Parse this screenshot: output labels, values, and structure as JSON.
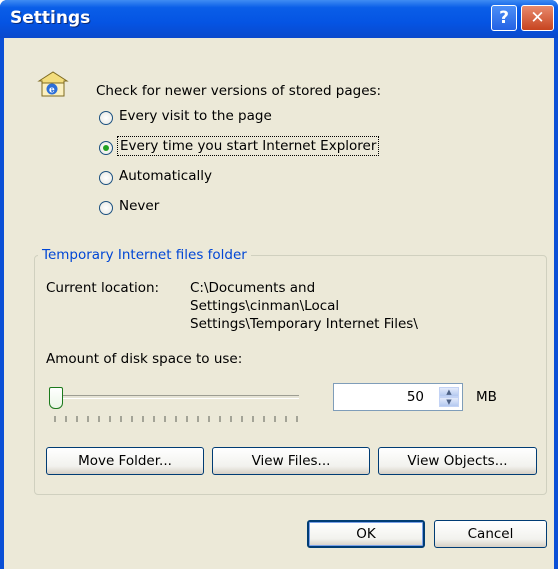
{
  "window": {
    "title": "Settings",
    "help_glyph": "?",
    "close_glyph": "✕"
  },
  "check_section": {
    "heading": "Check for newer versions of stored pages:",
    "options": [
      {
        "label": "Every visit to the page",
        "selected": false
      },
      {
        "label": "Every time you start Internet Explorer",
        "selected": true
      },
      {
        "label": "Automatically",
        "selected": false
      },
      {
        "label": "Never",
        "selected": false
      }
    ]
  },
  "temp_folder": {
    "group_title": "Temporary Internet files folder",
    "location_label": "Current location:",
    "location_lines": [
      "C:\\Documents and",
      "Settings\\cinman\\Local",
      "Settings\\Temporary Internet Files\\"
    ],
    "disk_label": "Amount of disk space to use:",
    "slider_value": 0.0,
    "disk_value": "50",
    "disk_unit": "MB"
  },
  "buttons": {
    "move_folder": "Move Folder...",
    "view_files": "View Files...",
    "view_objects": "View Objects...",
    "ok": "OK",
    "cancel": "Cancel"
  },
  "colors": {
    "title_bar": "#0554e3",
    "dialog_bg": "#ece9d8",
    "group_title": "#0046d5",
    "radio_dot": "#21a121"
  },
  "icons": {
    "header_icon": "ie-page-icon",
    "spinner_up": "spin-up-icon",
    "spinner_down": "spin-down-icon"
  }
}
